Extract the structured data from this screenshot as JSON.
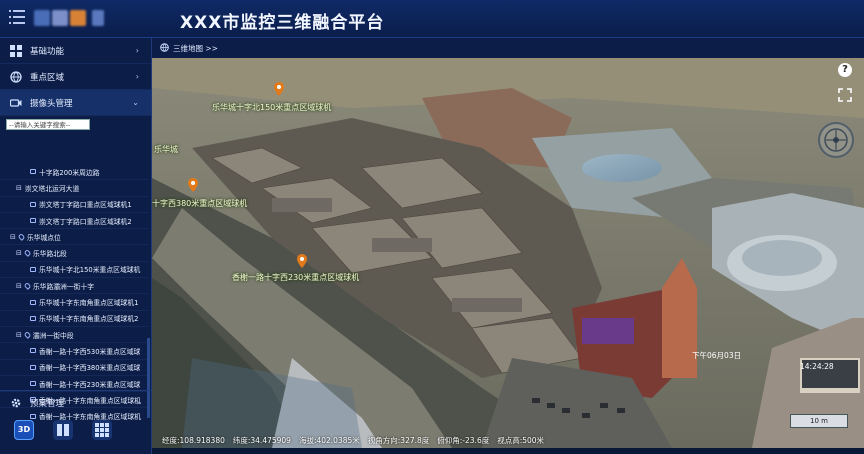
{
  "header": {
    "app_title": "XXX市监控三维融合平台",
    "menu_icon": "menu-icon",
    "logo_colors": [
      "#4a6db8",
      "#7c8fc8",
      "#d88236"
    ]
  },
  "sidebar": {
    "items": [
      {
        "label": "基础功能",
        "icon": "grid-icon",
        "chevron": "›"
      },
      {
        "label": "重点区域",
        "icon": "globe-icon",
        "chevron": "›"
      },
      {
        "label": "摄像头管理",
        "icon": "camera-icon",
        "chevron": "⌄"
      }
    ],
    "search_placeholder": "--请输入关键字搜索--",
    "tree": [
      {
        "level": 2,
        "kind": "cam",
        "label": "十字路200米周边路"
      },
      {
        "level": 1,
        "kind": "toggle",
        "toggle": "⊟",
        "label": "崇文塔北运河大道"
      },
      {
        "level": 2,
        "kind": "cam",
        "label": "崇文塔丁字路口重点区域球机1"
      },
      {
        "level": 2,
        "kind": "cam",
        "label": "崇文塔丁字路口重点区域球机2"
      },
      {
        "level": 0,
        "kind": "pin",
        "toggle": "⊟",
        "label": "乐华城点位"
      },
      {
        "level": 1,
        "kind": "pin",
        "toggle": "⊟",
        "label": "乐华路北段"
      },
      {
        "level": 2,
        "kind": "cam",
        "label": "乐华城十字北150米重点区域球机"
      },
      {
        "level": 1,
        "kind": "pin",
        "toggle": "⊟",
        "label": "乐华路灞洲一街十字"
      },
      {
        "level": 2,
        "kind": "cam",
        "label": "乐华城十字东南角重点区域球机1"
      },
      {
        "level": 2,
        "kind": "cam",
        "label": "乐华城十字东南角重点区域球机2"
      },
      {
        "level": 1,
        "kind": "pin",
        "toggle": "⊟",
        "label": "灞洲一街中段"
      },
      {
        "level": 2,
        "kind": "cam",
        "label": "香榭一路十字西530米重点区域球"
      },
      {
        "level": 2,
        "kind": "cam",
        "label": "香榭一路十字西380米重点区域球"
      },
      {
        "level": 2,
        "kind": "cam",
        "label": "香榭一路十字西230米重点区域球"
      },
      {
        "level": 2,
        "kind": "cam",
        "label": "香榭一路十字东南角重点区域球机"
      },
      {
        "level": 2,
        "kind": "cam",
        "label": "香榭一路十字东南角重点区域球机"
      }
    ],
    "bottom_item": {
      "label": "预案管理",
      "icon": "gear-icon",
      "chevron": "›"
    },
    "mode_buttons": [
      {
        "label": "3D",
        "icon": "3d-view-icon"
      },
      {
        "label": "",
        "icon": "split-view-icon"
      },
      {
        "label": "",
        "icon": "grid-view-icon"
      }
    ]
  },
  "main": {
    "breadcrumb": "三维地图 >>",
    "breadcrumb_icon": "globe-icon",
    "map_labels": [
      "乐华城十字北150米重点区域球机",
      "乐华城",
      "十字西380米重点区域球机",
      "香榭一路十字西230米重点区域球机"
    ],
    "billboard_text": "下午06月03日",
    "billboard_time": "14:24:28",
    "help_label": "?",
    "scale_label": "10 m",
    "status": {
      "longitude": "经度:108.918380",
      "latitude": "纬度:34.475909",
      "altitude": "海拔:402.0385米",
      "heading": "视角方向:327.8度",
      "pitch": "俯仰角:-23.6度",
      "view_height": "视点高:500米"
    }
  },
  "colors": {
    "header_bg": "#0f2a66",
    "sidebar_bg": "#0c1d48",
    "accent": "#3b6be0",
    "marker": "#e07a1a"
  }
}
